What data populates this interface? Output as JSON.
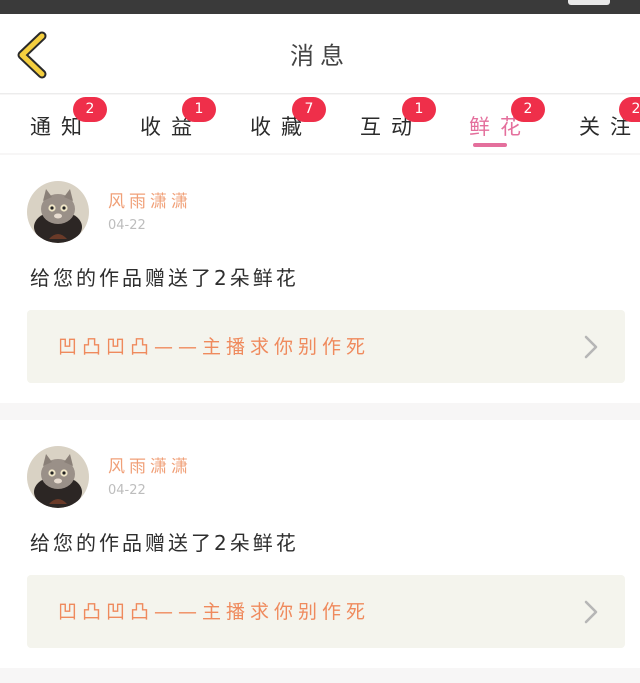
{
  "header": {
    "title": "消息"
  },
  "tabs": [
    {
      "label": "通知",
      "badge": "2"
    },
    {
      "label": "收益",
      "badge": "1"
    },
    {
      "label": "收藏",
      "badge": "7"
    },
    {
      "label": "互动",
      "badge": "1"
    },
    {
      "label": "鲜花",
      "badge": "2",
      "active": true
    },
    {
      "label": "关注",
      "badge": "2"
    }
  ],
  "messages": [
    {
      "sender": "风雨潇潇",
      "date": "04-22",
      "text": "给您的作品赠送了2朵鲜花",
      "work_title": "凹凸凹凸——主播求你别作死"
    },
    {
      "sender": "风雨潇潇",
      "date": "04-22",
      "text": "给您的作品赠送了2朵鲜花",
      "work_title": "凹凸凹凸——主播求你别作死"
    }
  ],
  "colors": {
    "accent": "#e46f9c",
    "badge": "#ef2f4a",
    "name": "#f0a078",
    "link": "#ef8a5d",
    "back_icon": "#f5cf3f"
  },
  "icons": {
    "back": "chevron-left-icon",
    "link_arrow": "chevron-right-icon",
    "avatar": "cat-avatar"
  }
}
